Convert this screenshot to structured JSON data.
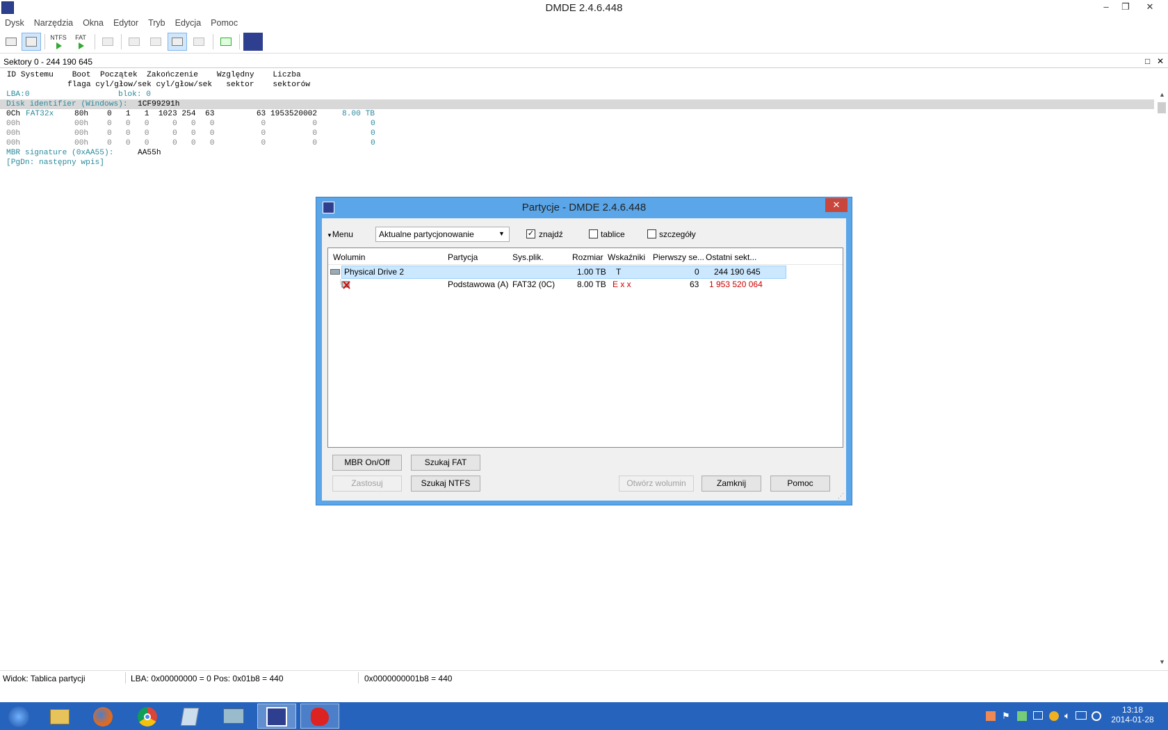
{
  "window": {
    "title": "DMDE 2.4.6.448",
    "min": "–",
    "max": "❐",
    "close": "✕"
  },
  "menu": [
    "Dysk",
    "Narzędzia",
    "Okna",
    "Edytor",
    "Tryb",
    "Edycja",
    "Pomoc"
  ],
  "toolbar": {
    "ntfs": "NTFS",
    "fat": "FAT"
  },
  "panel": {
    "title": "Sektory 0 - 244 190 645",
    "max": "□",
    "close": "✕"
  },
  "hex": {
    "header1": " ID Systemu    Boot  Początek  Zakończenie    Względny    Liczba",
    "header2": "              flaga cyl/głow/sek cyl/głow/sek   sektor    sektorów",
    "lba": "LBA:0",
    "blok": "blok: 0",
    "disk_id_label": "Disk identifier (Windows):",
    "disk_id_value": "1CF99291h",
    "rows": [
      {
        "id": "0Ch",
        "fs": "FAT32x",
        "rest": "80h    0   1   1  1023 254  63         63 1953520002",
        "size": "8.00 TB"
      },
      {
        "id": "00h",
        "fs": "",
        "rest": "00h    0   0   0     0   0   0          0          0",
        "size": "0"
      },
      {
        "id": "00h",
        "fs": "",
        "rest": "00h    0   0   0     0   0   0          0          0",
        "size": "0"
      },
      {
        "id": "00h",
        "fs": "",
        "rest": "00h    0   0   0     0   0   0          0          0",
        "size": "0"
      }
    ],
    "mbr_label": "MBR signature (0xAA55):",
    "mbr_value": "AA55h",
    "pgdn": "[PgDn: następny wpis]"
  },
  "status": {
    "view": "Widok: Tablica partycji",
    "lba": "LBA: 0x00000000 = 0  Pos: 0x01b8 = 440",
    "addr": "0x0000000001b8 = 440"
  },
  "dialog": {
    "title": "Partycje - DMDE 2.4.6.448",
    "close": "✕",
    "menu_label": "Menu",
    "select_value": "Aktualne partycjonowanie",
    "find_label": "znajdź",
    "find_checked": true,
    "tables_label": "tablice",
    "details_label": "szczegóły",
    "columns": [
      "Wolumin",
      "Partycja",
      "Sys.plik.",
      "Rozmiar",
      "Wskaźniki",
      "Pierwszy se...",
      "Ostatni sekt..."
    ],
    "rows": [
      {
        "volume": "Physical Drive 2",
        "partition": "",
        "fs": "",
        "size": "1.00 TB",
        "flags": "T",
        "first": "0",
        "last": "244 190 645"
      },
      {
        "volume": "",
        "partition": "Podstawowa (A)",
        "fs": "FAT32 (0C)",
        "size": "8.00 TB",
        "flags": "E x x",
        "first": "63",
        "last": "1 953 520 064"
      }
    ],
    "buttons": {
      "mbr": "MBR On/Off",
      "fat": "Szukaj FAT",
      "apply": "Zastosuj",
      "ntfs": "Szukaj NTFS",
      "open": "Otwórz wolumin",
      "close": "Zamknij",
      "help": "Pomoc"
    }
  },
  "tray": {
    "time": "13:18",
    "date": "2014-01-28"
  },
  "colors": {
    "taskbar": "#2563bd",
    "dialog_frame": "#5aa6e8",
    "selection": "#cce8ff",
    "cyan_text": "#2a8a9c",
    "error_red": "#cc0000"
  }
}
